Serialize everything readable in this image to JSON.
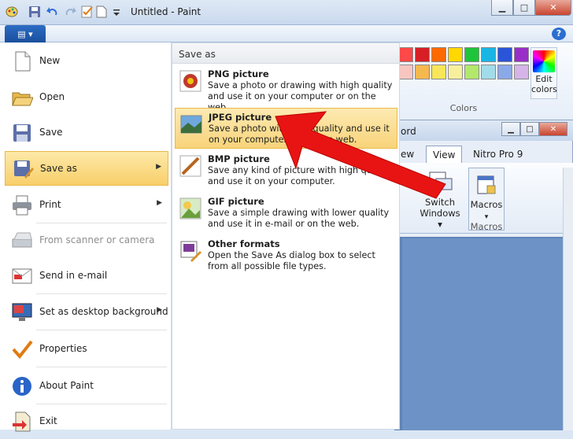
{
  "window": {
    "title": "Untitled - Paint",
    "help_label": "?",
    "min_label": "▭",
    "max_label": "□",
    "close_label": "✕"
  },
  "qat": {
    "icons": [
      "save-icon",
      "undo-icon",
      "redo-icon",
      "new-icon",
      "more-icon"
    ]
  },
  "ribbon": {
    "file_tab_label": "▤ ▾",
    "colors_label": "Colors",
    "edit_colors_label": "Edit colors",
    "palette": [
      "#ff4848",
      "#d81f26",
      "#ff6a00",
      "#ffd800",
      "#1ec43a",
      "#19b6e5",
      "#2a55d8",
      "#9a2ec9",
      "#f7c6c1",
      "#f5b84e",
      "#f7e65a",
      "#f7ef9b",
      "#b2e86b",
      "#a2dce9",
      "#8ba8e8",
      "#d6b4e8"
    ]
  },
  "word_window": {
    "title": "ord",
    "tab_view": "View",
    "tab_nitro": "Nitro Pro 9",
    "tab_prev": "ew",
    "switch_windows": "Switch Windows ▾",
    "macros_label": "Macros",
    "macros_group": "Macros"
  },
  "file_menu": {
    "items": [
      {
        "label": "New",
        "icon": "new-document-icon"
      },
      {
        "label": "Open",
        "icon": "open-folder-icon"
      },
      {
        "label": "Save",
        "icon": "save-icon"
      },
      {
        "label": "Save as",
        "icon": "save-as-icon",
        "arrow": "▶"
      },
      {
        "label": "Print",
        "icon": "printer-icon",
        "arrow": "▶"
      },
      {
        "label": "From scanner or camera",
        "icon": "scanner-icon"
      },
      {
        "label": "Send in e-mail",
        "icon": "email-icon"
      },
      {
        "label": "Set as desktop background",
        "icon": "desktop-icon",
        "arrow": "▶"
      },
      {
        "label": "Properties",
        "icon": "checkmark-icon"
      },
      {
        "label": "About Paint",
        "icon": "info-icon"
      },
      {
        "label": "Exit",
        "icon": "exit-icon"
      }
    ]
  },
  "save_as": {
    "header": "Save as",
    "items": [
      {
        "title": "PNG picture",
        "desc": "Save a photo or drawing with high quality and use it on your computer or on the web.",
        "icon": "png-icon"
      },
      {
        "title": "JPEG picture",
        "desc": "Save a photo with high quality and use it on your computer, or on the web.",
        "icon": "jpeg-icon"
      },
      {
        "title": "BMP picture",
        "desc": "Save any kind of picture with high quality and use it on your computer.",
        "icon": "bmp-icon"
      },
      {
        "title": "GIF picture",
        "desc": "Save a simple drawing with lower quality and use it in e-mail or on the web.",
        "icon": "gif-icon"
      },
      {
        "title": "Other formats",
        "desc": "Open the Save As dialog box to select from all possible file types.",
        "icon": "other-formats-icon"
      }
    ]
  },
  "annotation_color": "#e81414"
}
